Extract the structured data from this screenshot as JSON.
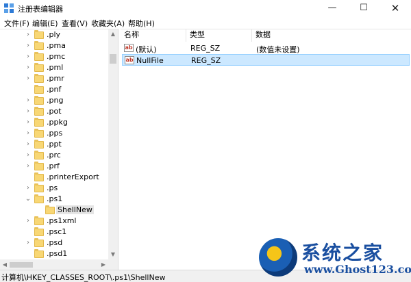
{
  "window": {
    "title": "注册表编辑器",
    "minimize_glyph": "—",
    "maximize_glyph": "☐",
    "close_glyph": "✕"
  },
  "menu": [
    "文件(F)",
    "编辑(E)",
    "查看(V)",
    "收藏夹(A)",
    "帮助(H)"
  ],
  "tree": {
    "items": [
      {
        "label": ".ply",
        "expander": "›"
      },
      {
        "label": ".pma",
        "expander": "›"
      },
      {
        "label": ".pmc",
        "expander": "›"
      },
      {
        "label": ".pml",
        "expander": "›"
      },
      {
        "label": ".pmr",
        "expander": "›"
      },
      {
        "label": ".pnf",
        "expander": ""
      },
      {
        "label": ".png",
        "expander": "›"
      },
      {
        "label": ".pot",
        "expander": "›"
      },
      {
        "label": ".ppkg",
        "expander": "›"
      },
      {
        "label": ".pps",
        "expander": "›"
      },
      {
        "label": ".ppt",
        "expander": "›"
      },
      {
        "label": ".prc",
        "expander": "›"
      },
      {
        "label": ".prf",
        "expander": "›"
      },
      {
        "label": ".printerExport",
        "expander": ""
      },
      {
        "label": ".ps",
        "expander": "›"
      },
      {
        "label": ".ps1",
        "expander": "⌄"
      },
      {
        "label": "ShellNew",
        "expander": ""
      },
      {
        "label": ".ps1xml",
        "expander": "›"
      },
      {
        "label": ".psc1",
        "expander": ""
      },
      {
        "label": ".psd",
        "expander": "›"
      },
      {
        "label": ".psd1",
        "expander": ""
      }
    ]
  },
  "columns": {
    "name": "名称",
    "type": "类型",
    "data": "数据"
  },
  "values": [
    {
      "name": "(默认)",
      "type": "REG_SZ",
      "data": "(数值未设置)",
      "icon": "ab"
    },
    {
      "name": "NullFile",
      "type": "REG_SZ",
      "data": "",
      "icon": "ab"
    }
  ],
  "status": {
    "path": "计算机\\HKEY_CLASSES_ROOT\\.ps1\\ShellNew"
  },
  "watermark": {
    "cn": "系统之家",
    "url": "www.Ghost123.com"
  },
  "colors": {
    "accent": "#2e7bd6",
    "selection": "#cce8ff",
    "folder": "#f8d775"
  }
}
